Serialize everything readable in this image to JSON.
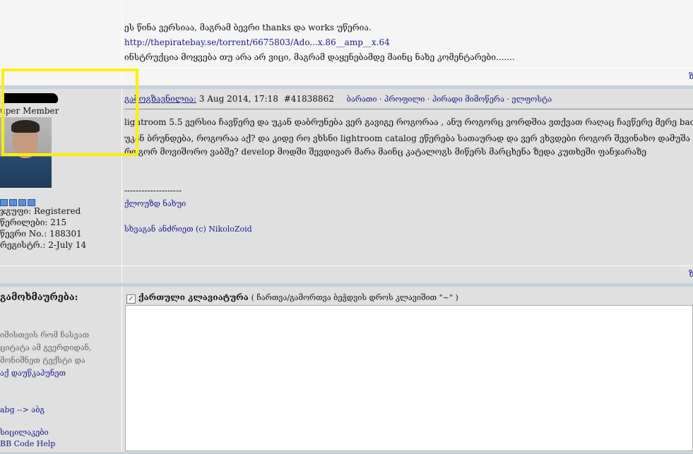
{
  "prev_post": {
    "lines": [
      "ეს წინა ვერსიაა, მაგრამ ბევრი thanks და works უწერია.",
      "http://thepiratebay.se/torrent/6675803/Ado...x.86__amp__x.64",
      "ინსტრუქცია მოყვება თუ არა არ ვიცი, მაგრამ დაყენებამდე მაინც ნახე კომენტარები......."
    ],
    "top_link_partial": "ზ"
  },
  "post": {
    "author_rank": "uper Member",
    "stars": 4,
    "group": "ჯგუფი: Registered",
    "posts": "წერილები: 215",
    "member_no": "წევრი No.: 188301",
    "registered": "რეგისტრ.: 2-July 14",
    "sent_label": "გამოგზავნილია:",
    "date": "3 Aug 2014, 17:18",
    "post_id": "#41838862",
    "actions": [
      "ბარათი",
      "პროფილი",
      "პირადი მიმოწერა",
      "ელფოსტა"
    ],
    "body": [
      "lightroom 5.5 ვერსია ჩავწერე და უკან დაბრუნება ვერ გავიგე როგორაა , ანუ როგორც ვორდშია ვთქვათ რაღაც ჩავწერე მერე back",
      "უკან ბრუნდება, როგორაა აქ? და კიდე რო ვხსნი lightroom catalog ეწერება სათაურად და ვერ ვხვდები როგორ შევინახო დამუშა",
      "როგორ მოვიშორო ვაბშე? develop მოდში შევდივარ მარა მაინც კატალოგს მიწერს მარცხენა ზედა კუთხეში ფანჯარაზე"
    ],
    "sig_divider": "--------------------",
    "sig_line1": "ქლოუზდ ნახუი",
    "sig_line2": "სხვაგან ანძრიეთ (c) NikoloZoid",
    "bottom_link_partial": "ზ"
  },
  "reply": {
    "title": "გამოხმაურება:",
    "help_lines": [
      "იმისთვის რომ ჩასვათ",
      "ციტატა ამ გვერდიდან,",
      "მონიშნეთ ტექსტი და"
    ],
    "help_link": "აქ დაუწკაპუნეთ",
    "translit": "abg --> აბგ",
    "smilies": "სიცილაკები",
    "bbcode": "BB Code Help",
    "keyboard_label": "ქართული კლავიატურა",
    "keyboard_hint": "( ჩართვა/გამორთვა ბეჭდვის დროს კლავიშით \"~\" )",
    "keyboard_checked": true,
    "textarea_value": ""
  },
  "colors": {
    "highlight": "#ffee00",
    "post_bg": "#e0e0e0",
    "separator": "#c4d0dc"
  }
}
